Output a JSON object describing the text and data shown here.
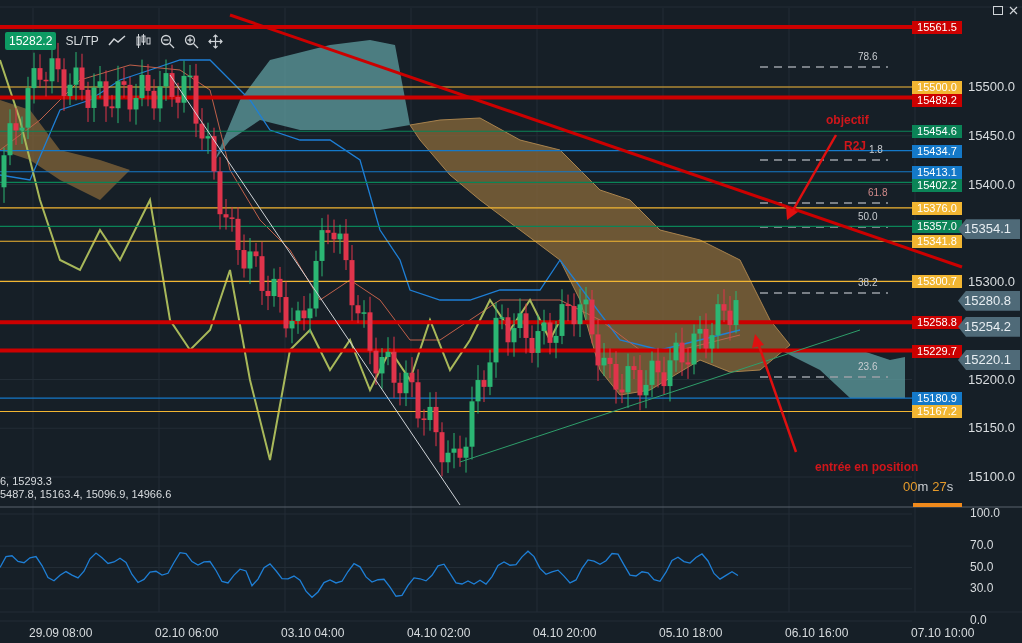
{
  "toolbar": {
    "price_badge": "15282.2",
    "sl_tp": "SL/TP"
  },
  "price_tags": [
    {
      "label": "15561.5",
      "color": "#cc0000"
    },
    {
      "label": "15500.0",
      "color": "#f2b632"
    },
    {
      "label": "15489.2",
      "color": "#cc0000"
    },
    {
      "label": "15454.6",
      "color": "#0b8457"
    },
    {
      "label": "15434.7",
      "color": "#1479c9"
    },
    {
      "label": "15413.1",
      "color": "#1479c9"
    },
    {
      "label": "15402.2",
      "color": "#0b8457"
    },
    {
      "label": "15376.0",
      "color": "#f2b632"
    },
    {
      "label": "15357.0",
      "color": "#0b8457"
    },
    {
      "label": "15341.8",
      "color": "#f2b632"
    },
    {
      "label": "15300.7",
      "color": "#f2b632"
    },
    {
      "label": "15258.8",
      "color": "#cc0000"
    },
    {
      "label": "15229.7",
      "color": "#cc0000"
    },
    {
      "label": "15180.9",
      "color": "#1479c9"
    },
    {
      "label": "15167.2",
      "color": "#f2b632"
    }
  ],
  "price_markers": [
    "15354.1",
    "15280.8",
    "15254.2",
    "15220.1"
  ],
  "price_axis": [
    "15500.0",
    "15450.0",
    "15400.0",
    "15300.0",
    "15200.0",
    "15150.0",
    "15100.0"
  ],
  "fib_labels": [
    "78.6",
    "1.8",
    "61.8",
    "50.0",
    "38.2",
    "23.6"
  ],
  "annotations": {
    "target": "objectif",
    "r2j": "R2J",
    "entry": "entrée en position"
  },
  "timer": {
    "minutes": "00",
    "minutes_unit": "m",
    "seconds": "27",
    "seconds_unit": "s"
  },
  "legend": [
    "6, 15293.3",
    "5487.8, 15163.4, 15096.9, 14966.6"
  ],
  "oscillator_axis": [
    "100.0",
    "70.0",
    "50.0",
    "30.0",
    "0.0"
  ],
  "time_axis": [
    "29.09 08:00",
    "02.10 06:00",
    "03.10 04:00",
    "04.10 02:00",
    "04.10 20:00",
    "05.10 18:00",
    "06.10 16:00",
    "07.10 10:00"
  ]
}
